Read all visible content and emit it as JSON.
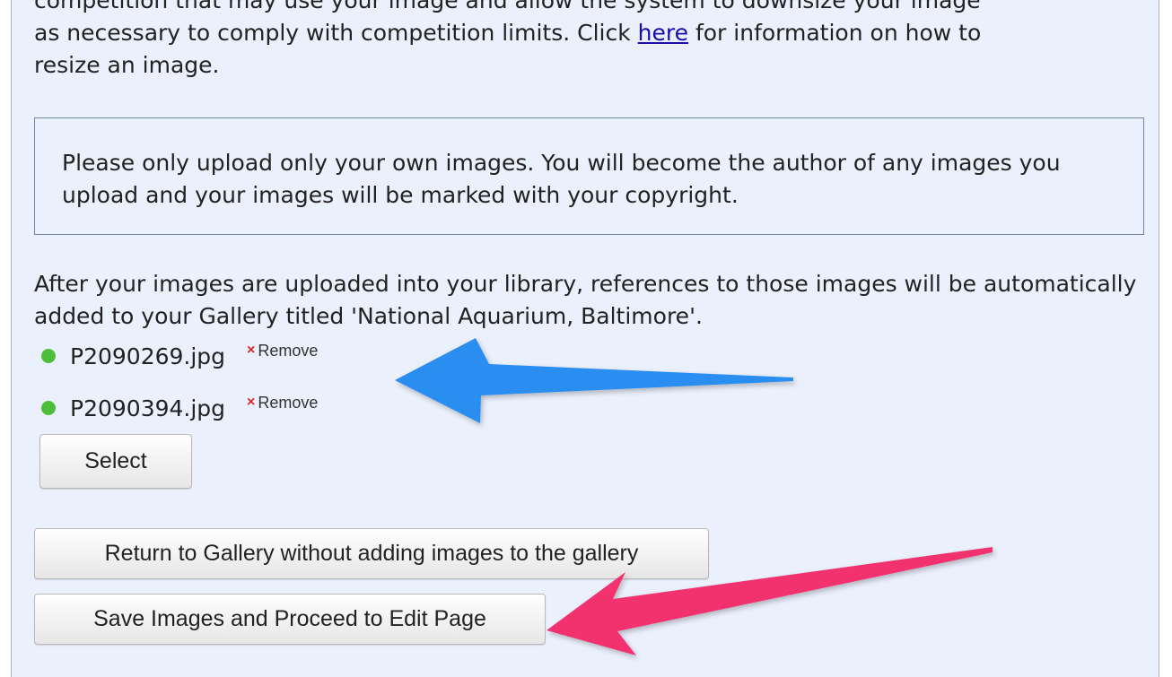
{
  "intro": {
    "line_clipped": "competition that may use your image and allow the system to downsize your image",
    "line_before_link": "as necessary to comply with competition limits. Click ",
    "link_label": "here",
    "line_after_link": " for information on how to",
    "line_last": "resize an image."
  },
  "notice": {
    "text": "Please only upload only your own images. You will become the author of any images you upload and your images will be marked with your copyright."
  },
  "gallery_info": {
    "text": "After your images are uploaded into your library, references to those images will be automatically added to your Gallery titled 'National Aquarium, Baltimore'."
  },
  "files": [
    {
      "name": "P2090269.jpg",
      "remove_label": "Remove"
    },
    {
      "name": "P2090394.jpg",
      "remove_label": "Remove"
    }
  ],
  "buttons": {
    "select": "Select",
    "return": "Return to Gallery without adding images to the gallery",
    "save": "Save Images and Proceed to Edit Page"
  },
  "colors": {
    "panel_bg": "#eaf0fc",
    "status_dot": "#4bbf3a",
    "remove_x": "#d8262c",
    "arrow_blue": "#2c8ef0",
    "arrow_pink": "#f2316e"
  }
}
